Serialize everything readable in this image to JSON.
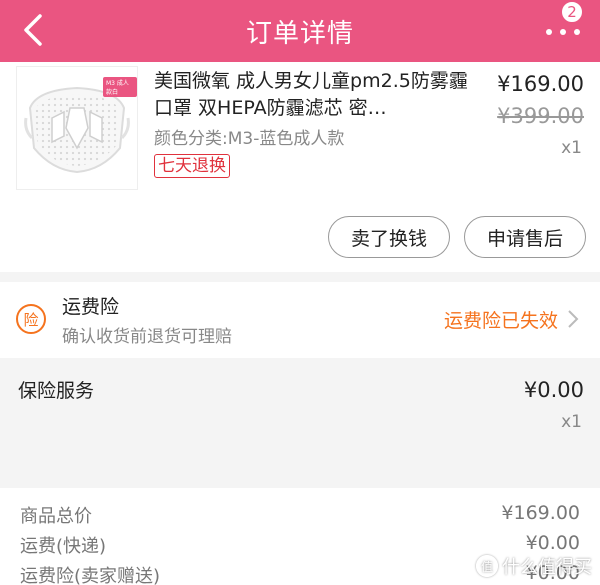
{
  "header": {
    "title": "订单详情",
    "badge_count": "2"
  },
  "product": {
    "thumb_tag": "M3 成人款白",
    "name": "美国微氧 成人男女儿童pm2.5防雾霾口罩 双HEPA防霾滤芯 密…",
    "spec": "颜色分类:M3-蓝色成人款",
    "tag": "七天退换",
    "price": "¥169.00",
    "original_price": "¥399.00",
    "quantity": "x1",
    "sell_button": "卖了换钱",
    "after_sale_button": "申请售后"
  },
  "shipping_insurance": {
    "icon_text": "险",
    "title": "运费险",
    "subtitle": "确认收货前退货可理赔",
    "status": "运费险已失效"
  },
  "insurance_service": {
    "title": "保险服务",
    "price": "¥0.00",
    "quantity": "x1"
  },
  "summary": {
    "rows": [
      {
        "label": "商品总价",
        "value": "¥169.00"
      },
      {
        "label": "运费(快递)",
        "value": "¥0.00"
      },
      {
        "label": "运费险(卖家赠送)",
        "value": "¥0.00"
      }
    ]
  },
  "watermark": {
    "icon_text": "值",
    "text": "什么值得买"
  },
  "colors": {
    "header_bg": "#ea5581",
    "orange": "#f5731e",
    "red_tag": "#e0323d"
  }
}
